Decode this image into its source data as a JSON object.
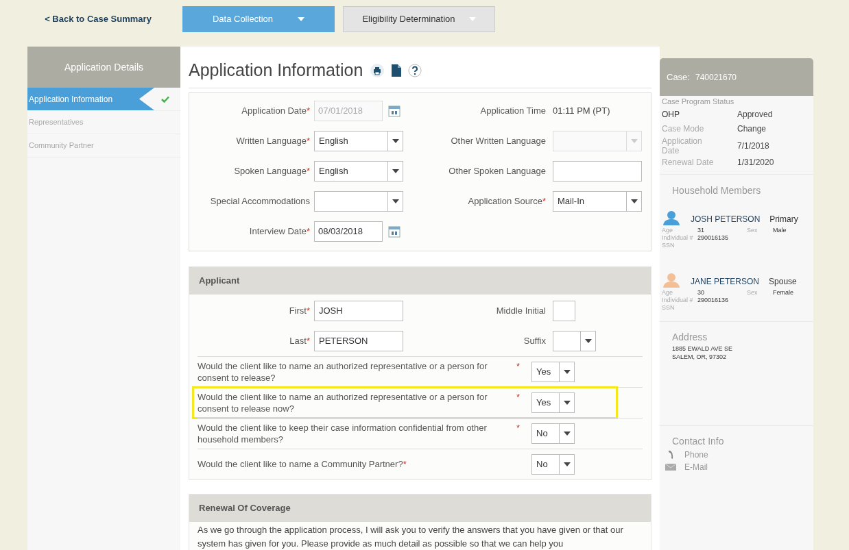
{
  "back_link": "< Back to Case Summary",
  "tabs": [
    {
      "label": "Data Collection",
      "selected": true
    },
    {
      "label": "Eligibility Determination",
      "selected": false
    }
  ],
  "sidebar": {
    "title": "Application Details",
    "items": [
      {
        "label": "Application Information",
        "selected": true,
        "completed": true
      },
      {
        "label": "Representatives",
        "selected": false,
        "completed": false
      },
      {
        "label": "Community Partner",
        "selected": false,
        "completed": false
      }
    ]
  },
  "page_title": "Application Information",
  "application_form": {
    "rows": [
      [
        {
          "label": "Application Date",
          "required_mark": "*",
          "kind": "date",
          "value": "07/01/2018",
          "disabled": true
        },
        {
          "label": "Application Time",
          "kind": "readonly",
          "value": "01:11 PM (PT)",
          "disabled": false
        }
      ],
      [
        {
          "label": "Written Language",
          "required_mark": "*",
          "kind": "select",
          "value": "English",
          "disabled": false
        },
        {
          "label": "Other Written Language",
          "kind": "select",
          "disabled": true
        }
      ],
      [
        {
          "label": "Spoken Language",
          "required_mark": "*",
          "kind": "select",
          "value": "English",
          "disabled": false
        },
        {
          "label": "Other Spoken Language",
          "kind": "text",
          "disabled": false
        }
      ],
      [
        {
          "label": "Special Accommodations",
          "kind": "select",
          "disabled": false
        },
        {
          "label": "Application Source",
          "required_mark": "*",
          "kind": "select",
          "value": "Mail-In",
          "disabled": false
        }
      ],
      [
        {
          "label": "Interview Date",
          "required_mark": "*",
          "kind": "date",
          "value": "08/03/2018",
          "disabled": false
        }
      ]
    ]
  },
  "applicant": {
    "title": "Applicant",
    "rows": [
      [
        {
          "label": "First",
          "required_mark": "*",
          "kind": "text",
          "value": "JOSH",
          "disabled": false
        },
        {
          "label": "Middle Initial",
          "kind": "short",
          "disabled": false
        }
      ],
      [
        {
          "label": "Last",
          "required_mark": "*",
          "kind": "text",
          "value": "PETERSON",
          "disabled": false
        },
        {
          "label": "Suffix",
          "kind": "short_select",
          "disabled": false
        }
      ]
    ],
    "questions": [
      {
        "text": "Would the client like to name an authorized representative or a person for consent to release?",
        "required_mark": "*",
        "value": "Yes",
        "highlighted": false
      },
      {
        "text": "Would the client like to name an authorized representative or a person for consent to release now?",
        "required_mark": "*",
        "value": "Yes",
        "highlighted": true
      },
      {
        "text": "Would the client like to keep their case information confidential from other household members?",
        "required_mark": "*",
        "value": "No",
        "highlighted": false
      },
      {
        "text": "Would the client like to name a Community Partner?",
        "required_mark": "*",
        "value": "No",
        "highlighted": false
      }
    ]
  },
  "renewal": {
    "title": "Renewal Of Coverage",
    "text": "As we go through the application process, I will ask you to verify the answers that you have given or that our system has given for you. Please provide as much detail as possible so that we can help you"
  },
  "case_panel": {
    "label": "Case:",
    "number": "740021670",
    "status_title": "Case Program Status",
    "status_rows": [
      {
        "kind": "program",
        "label": "OHP",
        "value": "Approved"
      },
      {
        "kind": "field",
        "label": "Case Mode",
        "value": "Change"
      },
      {
        "kind": "field",
        "label": "Application Date",
        "value": "7/1/2018"
      },
      {
        "kind": "field",
        "label": "Renewal Date",
        "value": "1/31/2020"
      }
    ],
    "household_title": "Household Members",
    "members": [
      {
        "name": "JOSH PETERSON",
        "role": "Primary",
        "color": "#4a9fd8",
        "age_label": "Age",
        "age": "31",
        "sex_label": "Sex",
        "sex": "Male",
        "individual_label": "Individual #",
        "individual": "290016135",
        "ssn_label": "SSN"
      },
      {
        "name": "JANE PETERSON",
        "role": "Spouse",
        "color": "#f4bf94",
        "age_label": "Age",
        "age": "30",
        "sex_label": "Sex",
        "sex": "Female",
        "individual_label": "Individual #",
        "individual": "290016136",
        "ssn_label": "SSN"
      }
    ],
    "address_title": "Address",
    "address_lines": [
      "1885 EWALD AVE SE",
      "SALEM, OR, 97302"
    ],
    "contact_title": "Contact Info",
    "contacts": [
      {
        "kind": "phone",
        "label": "Phone"
      },
      {
        "kind": "email",
        "label": "E-Mail"
      }
    ]
  }
}
